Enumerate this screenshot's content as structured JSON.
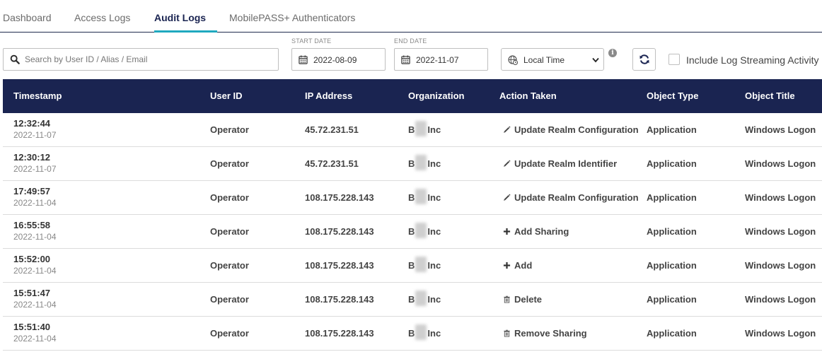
{
  "tabs": [
    {
      "label": "Dashboard",
      "active": false
    },
    {
      "label": "Access Logs",
      "active": false
    },
    {
      "label": "Audit Logs",
      "active": true
    },
    {
      "label": "MobilePASS+ Authenticators",
      "active": false
    }
  ],
  "filters": {
    "search_placeholder": "Search by User ID / Alias / Email",
    "start_label": "START DATE",
    "start_value": "2022-08-09",
    "end_label": "END DATE",
    "end_value": "2022-11-07",
    "timezone": "Local Time",
    "include_streaming_label": "Include Log Streaming Activity",
    "include_streaming_checked": false
  },
  "table": {
    "headers": [
      "Timestamp",
      "User ID",
      "IP Address",
      "Organization",
      "Action Taken",
      "Object Type",
      "Object Title"
    ],
    "rows": [
      {
        "time": "12:32:44",
        "date": "2022-11-07",
        "user": "Operator",
        "ip": "45.72.231.51",
        "org_a": "B",
        "org_b": "Inc",
        "action_icon": "pencil-icon",
        "action": "Update Realm Configuration",
        "type": "Application",
        "title": "Windows Logon"
      },
      {
        "time": "12:30:12",
        "date": "2022-11-07",
        "user": "Operator",
        "ip": "45.72.231.51",
        "org_a": "B",
        "org_b": "Inc",
        "action_icon": "pencil-icon",
        "action": "Update Realm Identifier",
        "type": "Application",
        "title": "Windows Logon"
      },
      {
        "time": "17:49:57",
        "date": "2022-11-04",
        "user": "Operator",
        "ip": "108.175.228.143",
        "org_a": "B",
        "org_b": "Inc",
        "action_icon": "pencil-icon",
        "action": "Update Realm Configuration",
        "type": "Application",
        "title": "Windows Logon"
      },
      {
        "time": "16:55:58",
        "date": "2022-11-04",
        "user": "Operator",
        "ip": "108.175.228.143",
        "org_a": "B",
        "org_b": "Inc",
        "action_icon": "plus-icon",
        "action": "Add Sharing",
        "type": "Application",
        "title": "Windows Logon"
      },
      {
        "time": "15:52:00",
        "date": "2022-11-04",
        "user": "Operator",
        "ip": "108.175.228.143",
        "org_a": "B",
        "org_b": "Inc",
        "action_icon": "plus-icon",
        "action": "Add",
        "type": "Application",
        "title": "Windows Logon"
      },
      {
        "time": "15:51:47",
        "date": "2022-11-04",
        "user": "Operator",
        "ip": "108.175.228.143",
        "org_a": "B",
        "org_b": "Inc",
        "action_icon": "trash-icon",
        "action": "Delete",
        "type": "Application",
        "title": "Windows Logon"
      },
      {
        "time": "15:51:40",
        "date": "2022-11-04",
        "user": "Operator",
        "ip": "108.175.228.143",
        "org_a": "B",
        "org_b": "Inc",
        "action_icon": "trash-icon",
        "action": "Remove Sharing",
        "type": "Application",
        "title": "Windows Logon"
      }
    ]
  },
  "colors": {
    "header_bg": "#1a2451",
    "tab_accent": "#1fa9bf"
  }
}
